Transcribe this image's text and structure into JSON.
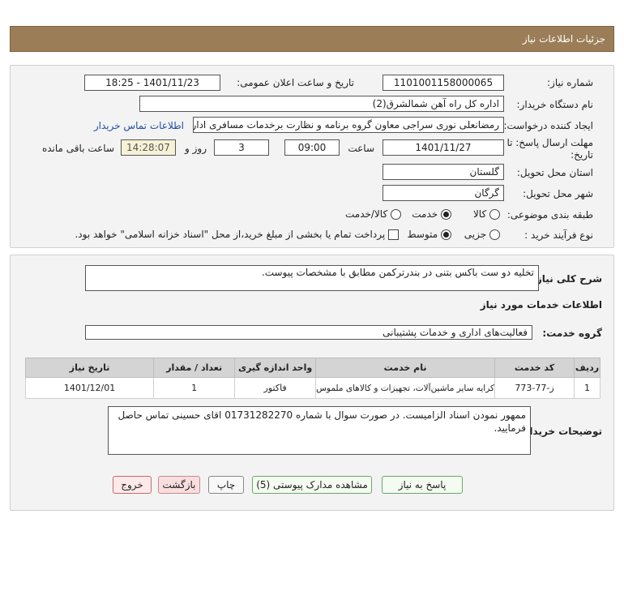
{
  "header": {
    "title": "جزئیات اطلاعات نیاز"
  },
  "form": {
    "need_number_label": "شماره نیاز:",
    "need_number": "1101001158000065",
    "announce_label": "تاریخ و ساعت اعلان عمومی:",
    "announce_value": "1401/11/23 - 18:25",
    "buyer_org_label": "نام دستگاه خریدار:",
    "buyer_org": "اداره کل راه آهن شمالشرق(2)",
    "creator_label": "ایجاد کننده درخواست:",
    "creator": "رمضانعلی نوری سراجی معاون گروه برنامه و نظارت برخدمات مسافری اداره کل راه آهن شمالشرق(2)",
    "contact_link": "اطلاعات تماس خریدار",
    "deadline_label_line1": "مهلت ارسال پاسخ: تا",
    "deadline_label_line2": "تاریخ:",
    "deadline_date": "1401/11/27",
    "time_label": "ساعت",
    "deadline_time": "09:00",
    "days_value": "3",
    "days_label": "روز و",
    "remaining_time": "14:28:07",
    "remaining_label": "ساعت باقی مانده",
    "province_label": "استان محل تحویل:",
    "province": "گلستان",
    "city_label": "شهر محل تحویل:",
    "city": "گرگان",
    "category_label": "طبقه بندی موضوعی:",
    "category_options": [
      "کالا",
      "خدمت",
      "کالا/خدمت"
    ],
    "category_selected": "خدمت",
    "process_label": "نوع فرآیند خرید :",
    "process_options": [
      "جزیی",
      "متوسط"
    ],
    "process_selected": "متوسط",
    "payment_note": "پرداخت تمام یا بخشی از مبلغ خرید،از محل \"اسناد خزانه اسلامی\" خواهد بود."
  },
  "summary": {
    "label": "شرح کلی نیاز:",
    "value": "تخلیه دو ست باکس بتنی در بندرترکمن مطابق با مشخصات پیوست."
  },
  "services": {
    "section_title": "اطلاعات خدمات مورد نیاز",
    "group_label": "گروه خدمت:",
    "group_value": "فعالیت‌های اداری و خدمات پشتیبانی",
    "table": {
      "headers": [
        "ردیف",
        "کد خدمت",
        "نام خدمت",
        "واحد اندازه گیری",
        "تعداد / مقدار",
        "تاریخ نیاز"
      ],
      "rows": [
        [
          "1",
          "ز-77-773",
          "کرایه سایر ماشین‌آلات، تجهیزات و کالاهای ملموس",
          "فاکتور",
          "1",
          "1401/12/01"
        ]
      ]
    }
  },
  "buyer_notes": {
    "label": "توضیحات خریدار:",
    "value": "ممهور نمودن اسناد الزامیست. در صورت سوال با شماره 01731282270 اقای حسینی تماس حاصل فرمایید."
  },
  "buttons": {
    "reply": "پاسخ به نیاز",
    "attachments": "مشاهده مدارک پیوستی (5)",
    "print": "چاپ",
    "back": "بازگشت",
    "exit": "خروج"
  }
}
